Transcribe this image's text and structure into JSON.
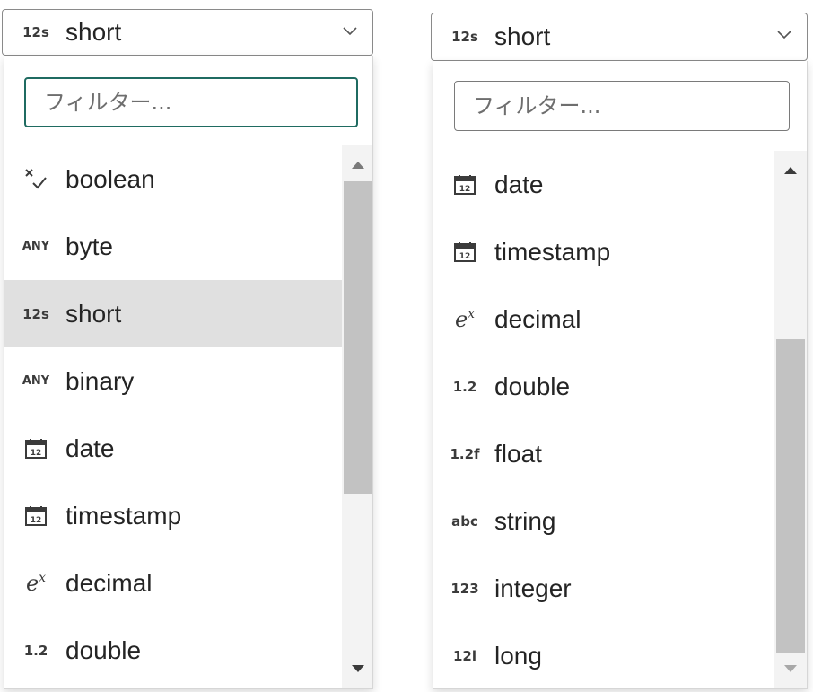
{
  "left": {
    "combo": {
      "icon": "12s",
      "label": "short"
    },
    "filter": {
      "placeholder": "フィルター..."
    },
    "items": [
      {
        "icon": "boolean",
        "label": "boolean"
      },
      {
        "icon": "ANY",
        "label": "byte"
      },
      {
        "icon": "12s",
        "label": "short",
        "selected": true
      },
      {
        "icon": "ANY",
        "label": "binary"
      },
      {
        "icon": "calendar",
        "label": "date"
      },
      {
        "icon": "calendar",
        "label": "timestamp"
      },
      {
        "icon": "ex",
        "label": "decimal"
      },
      {
        "icon": "1.2",
        "label": "double"
      }
    ]
  },
  "right": {
    "combo": {
      "icon": "12s",
      "label": "short"
    },
    "filter": {
      "placeholder": "フィルター..."
    },
    "items": [
      {
        "icon": "calendar",
        "label": "date"
      },
      {
        "icon": "calendar",
        "label": "timestamp"
      },
      {
        "icon": "ex",
        "label": "decimal"
      },
      {
        "icon": "1.2",
        "label": "double"
      },
      {
        "icon": "1.2f",
        "label": "float"
      },
      {
        "icon": "abc",
        "label": "string"
      },
      {
        "icon": "123",
        "label": "integer"
      },
      {
        "icon": "12l",
        "label": "long"
      }
    ]
  },
  "colors": {
    "focus_border": "#1f6b61",
    "selected_bg": "#e0e0e0",
    "scroll_thumb": "#c2c2c2"
  }
}
